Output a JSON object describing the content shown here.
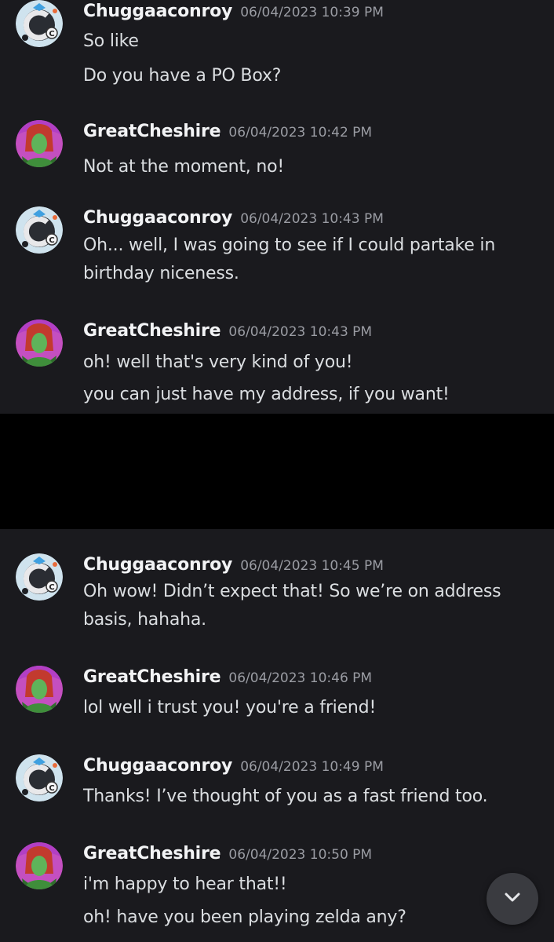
{
  "messages": [
    {
      "user": "Chuggaaconroy",
      "avatar": "chuggaaconroy-avatar",
      "timestamp": "06/04/2023 10:39 PM",
      "lines": [
        "So like",
        "Do you have a PO Box?"
      ]
    },
    {
      "user": "GreatCheshire",
      "avatar": "greatcheshire-avatar",
      "timestamp": "06/04/2023 10:42 PM",
      "lines": [
        "Not at the moment, no!"
      ]
    },
    {
      "user": "Chuggaaconroy",
      "avatar": "chuggaaconroy-avatar",
      "timestamp": "06/04/2023 10:43 PM",
      "lines": [
        "Oh... well, I was going to see if I could partake in",
        "birthday niceness."
      ]
    },
    {
      "user": "GreatCheshire",
      "avatar": "greatcheshire-avatar",
      "timestamp": "06/04/2023 10:43 PM",
      "lines": [
        "oh! well that's very kind of you!",
        "you can just have my address, if you want!"
      ]
    },
    {
      "user": "Chuggaaconroy",
      "avatar": "chuggaaconroy-avatar",
      "timestamp": "06/04/2023 10:45 PM",
      "lines": [
        "Oh wow! Didn’t expect that! So we’re on address",
        "basis, hahaha."
      ]
    },
    {
      "user": "GreatCheshire",
      "avatar": "greatcheshire-avatar",
      "timestamp": "06/04/2023 10:46 PM",
      "lines": [
        "lol well i trust you! you're a friend!"
      ]
    },
    {
      "user": "Chuggaaconroy",
      "avatar": "chuggaaconroy-avatar",
      "timestamp": "06/04/2023 10:49 PM",
      "lines": [
        "Thanks! I’ve thought of you as a fast friend too."
      ]
    },
    {
      "user": "GreatCheshire",
      "avatar": "greatcheshire-avatar",
      "timestamp": "06/04/2023 10:50 PM",
      "lines": [
        "i'm happy to hear that!!",
        "oh! have you been playing zelda any?"
      ]
    }
  ],
  "scroll_button_icon": "chevron-down-icon",
  "colors": {
    "background": "#1a1a1e",
    "username": "#f2f3f5",
    "timestamp": "#9a9ca3",
    "message_text": "#dbdee1",
    "redaction": "#000000",
    "scroll_button": "#3a3b40"
  }
}
